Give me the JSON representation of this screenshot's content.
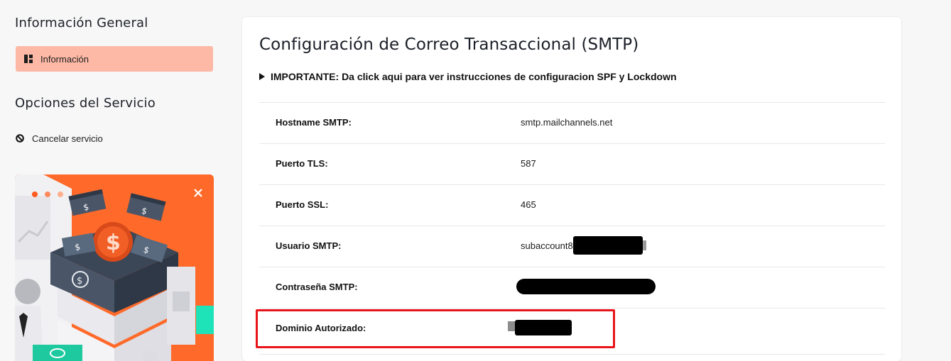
{
  "sidebar": {
    "general_title": "Información General",
    "info_item": "Información",
    "options_title": "Opciones del Servicio",
    "cancel_item": "Cancelar servicio"
  },
  "main": {
    "title": "Configuración de Correo Transaccional (SMTP)",
    "notice": "IMPORTANTE: Da click aqui para ver instrucciones de configuracion SPF y Lockdown",
    "rows": [
      {
        "label": "Hostname SMTP:",
        "value": "smtp.mailchannels.net"
      },
      {
        "label": "Puerto TLS:",
        "value": "587"
      },
      {
        "label": "Puerto SSL:",
        "value": "465"
      },
      {
        "label": "Usuario SMTP:",
        "value": "subaccount8"
      },
      {
        "label": "Contraseña SMTP:",
        "value": ""
      },
      {
        "label": "Dominio Autorizado:",
        "value": ""
      }
    ]
  },
  "colors": {
    "active_nav_bg": "#fdb9a6",
    "promo_bg": "#ff6a2a",
    "highlight_border": "#e8141a"
  }
}
